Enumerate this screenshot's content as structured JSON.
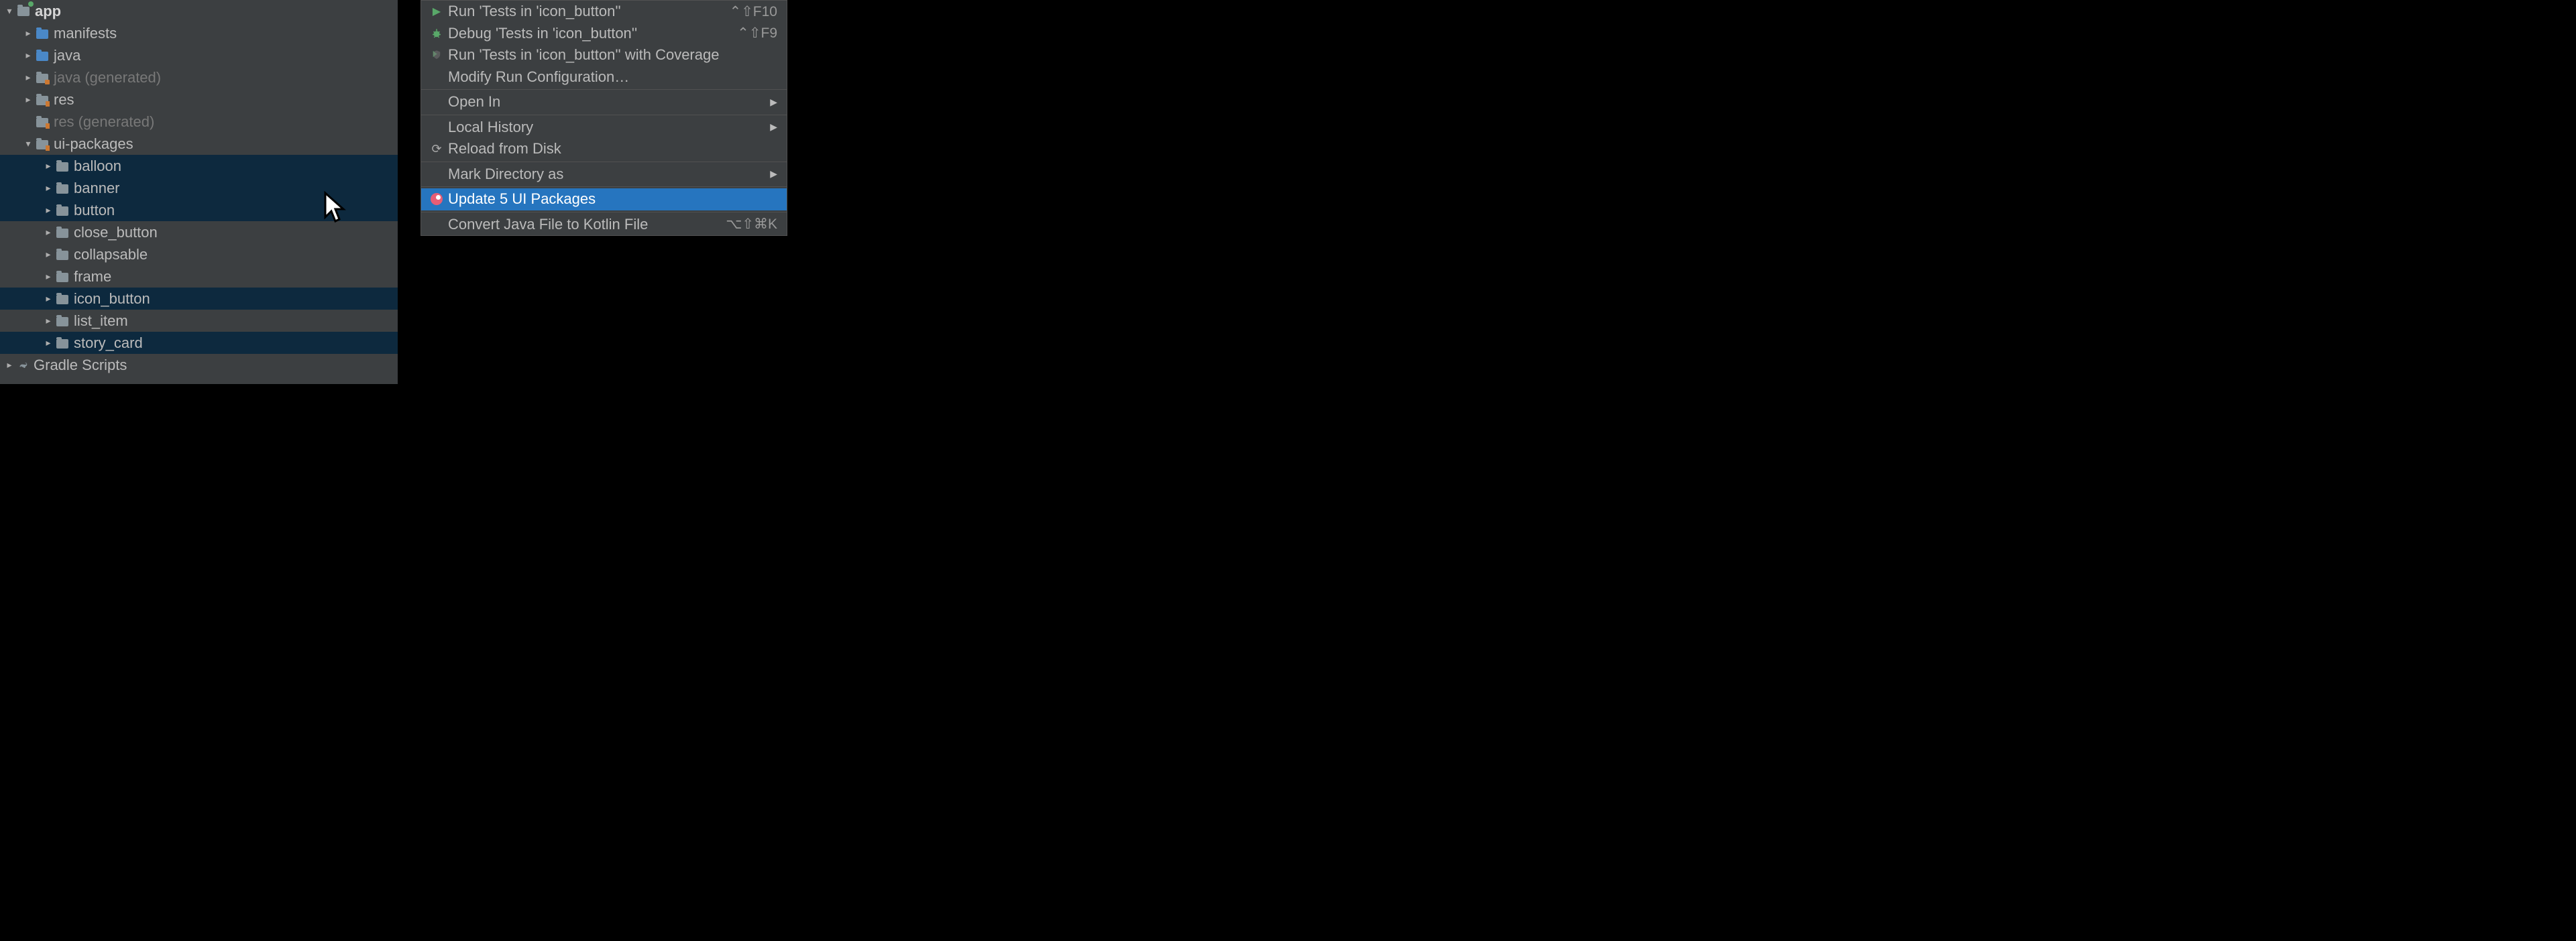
{
  "tree": {
    "app": "app",
    "manifests": "manifests",
    "java": "java",
    "java_gen_label": "java",
    "java_gen_suffix": "(generated)",
    "res": "res",
    "res_gen_label": "res",
    "res_gen_suffix": "(generated)",
    "ui_packages": "ui-packages",
    "balloon": "balloon",
    "banner": "banner",
    "button": "button",
    "close_button": "close_button",
    "collapsable": "collapsable",
    "frame": "frame",
    "icon_button": "icon_button",
    "list_item": "list_item",
    "story_card": "story_card",
    "gradle_scripts": "Gradle Scripts"
  },
  "menu": {
    "run": "Run 'Tests in 'icon_button''",
    "run_sc": "⌃⇧F10",
    "debug": "Debug 'Tests in 'icon_button''",
    "debug_sc": "⌃⇧F9",
    "coverage": "Run 'Tests in 'icon_button'' with Coverage",
    "modify": "Modify Run Configuration…",
    "open_in": "Open In",
    "local_history": "Local History",
    "reload": "Reload from Disk",
    "mark_dir": "Mark Directory as",
    "update_pkgs": "Update 5 UI Packages",
    "convert": "Convert Java File to Kotlin File",
    "convert_sc": "⌥⇧⌘K"
  }
}
